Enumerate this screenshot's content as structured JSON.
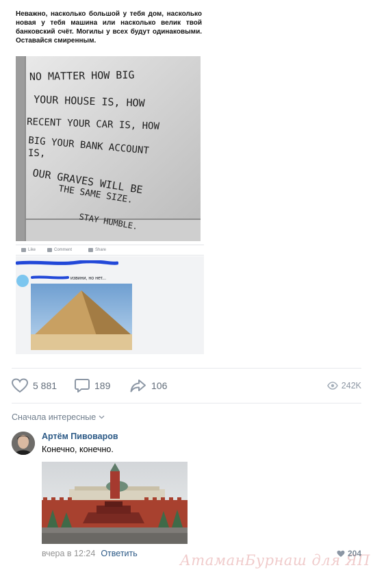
{
  "post": {
    "caption": "Неважно, насколько большой у тебя дом, насколько новая у тебя машина или насколько велик твой банковский счёт. Могилы у всех будут одинаковыми. Оставайся смиренным.",
    "photo_text_lines": [
      "NO MATTER HOW BIG",
      "YOUR HOUSE IS, HOW",
      "RECENT YOUR CAR IS, HOW",
      "BIG YOUR BANK ACCOUNT",
      "IS,",
      "OUR GRAVES WILL BE",
      "THE SAME SIZE.",
      "STAY HUMBLE."
    ],
    "fb_actions": {
      "like": "Like",
      "comment": "Comment",
      "share": "Share"
    },
    "fb_reply_text": "извини, но нет..."
  },
  "actions": {
    "likes": "5 881",
    "comments": "189",
    "shares": "106",
    "views": "242K"
  },
  "comments_sort": "Сначала интересные",
  "comment": {
    "author": "Артём Пивоваров",
    "text": "Конечно, конечно.",
    "time": "вчера в 12:24",
    "reply_label": "Ответить",
    "likes": "204"
  },
  "watermark": "АтаманБурнаш для ЯП",
  "icons": {
    "like": "heart-icon",
    "comment": "speech-bubble-icon",
    "share": "share-arrow-icon",
    "views": "eye-icon",
    "sort": "chevron-down-icon"
  }
}
